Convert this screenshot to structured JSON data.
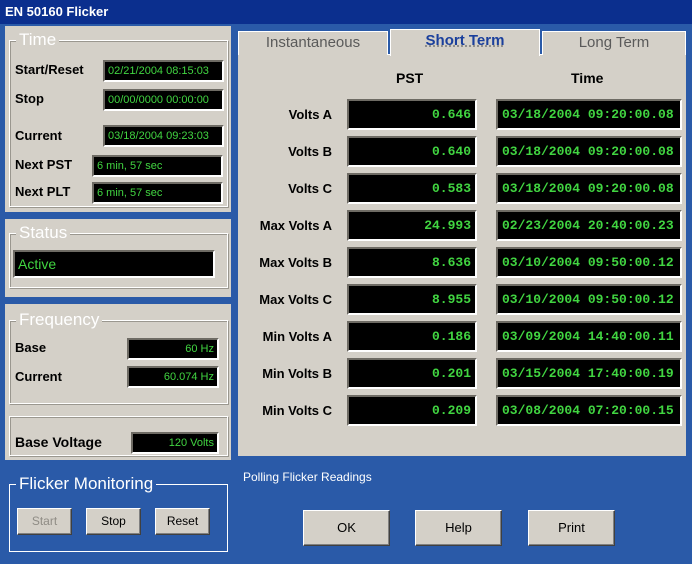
{
  "window": {
    "title": "EN 50160 Flicker"
  },
  "time": {
    "legend": "Time",
    "start_reset": {
      "label": "Start/Reset",
      "value": "02/21/2004 08:15:03"
    },
    "stop": {
      "label": "Stop",
      "value": "00/00/0000 00:00:00"
    },
    "current": {
      "label": "Current",
      "value": "03/18/2004 09:23:03"
    },
    "next_pst": {
      "label": "Next PST",
      "value": "6 min, 57 sec"
    },
    "next_plt": {
      "label": "Next PLT",
      "value": "6 min, 57 sec"
    }
  },
  "status": {
    "legend": "Status",
    "value": "Active"
  },
  "frequency": {
    "legend": "Frequency",
    "base": {
      "label": "Base",
      "value": "60 Hz"
    },
    "current": {
      "label": "Current",
      "value": "60.074 Hz"
    }
  },
  "base_voltage": {
    "label": "Base Voltage",
    "value": "120 Volts"
  },
  "monitoring": {
    "legend": "Flicker Monitoring",
    "start": "Start",
    "stop": "Stop",
    "reset": "Reset"
  },
  "tabs": [
    {
      "label": "Instantaneous",
      "active": false
    },
    {
      "label": "Short Term",
      "active": true
    },
    {
      "label": "Long Term",
      "active": false
    }
  ],
  "table": {
    "headers": {
      "pst": "PST",
      "time": "Time"
    },
    "rows": [
      {
        "label": "Volts A",
        "pst": "0.646",
        "time": "03/18/2004 09:20:00.08"
      },
      {
        "label": "Volts B",
        "pst": "0.640",
        "time": "03/18/2004 09:20:00.08"
      },
      {
        "label": "Volts C",
        "pst": "0.583",
        "time": "03/18/2004 09:20:00.08"
      },
      {
        "label": "Max Volts A",
        "pst": "24.993",
        "time": "02/23/2004 20:40:00.23"
      },
      {
        "label": "Max Volts B",
        "pst": "8.636",
        "time": "03/10/2004 09:50:00.12"
      },
      {
        "label": "Max Volts C",
        "pst": "8.955",
        "time": "03/10/2004 09:50:00.12"
      },
      {
        "label": "Min Volts A",
        "pst": "0.186",
        "time": "03/09/2004 14:40:00.11"
      },
      {
        "label": "Min Volts B",
        "pst": "0.201",
        "time": "03/15/2004 17:40:00.19"
      },
      {
        "label": "Min Volts C",
        "pst": "0.209",
        "time": "03/08/2004 07:20:00.15"
      }
    ]
  },
  "footer": {
    "status_text": "Polling Flicker Readings",
    "ok": "OK",
    "help": "Help",
    "print": "Print"
  },
  "colors": {
    "lcd_text": "#41d541",
    "title_bar": "#0b2f8e",
    "frame_blue": "#2a5aa8",
    "tab_active": "#1a3f9c"
  }
}
